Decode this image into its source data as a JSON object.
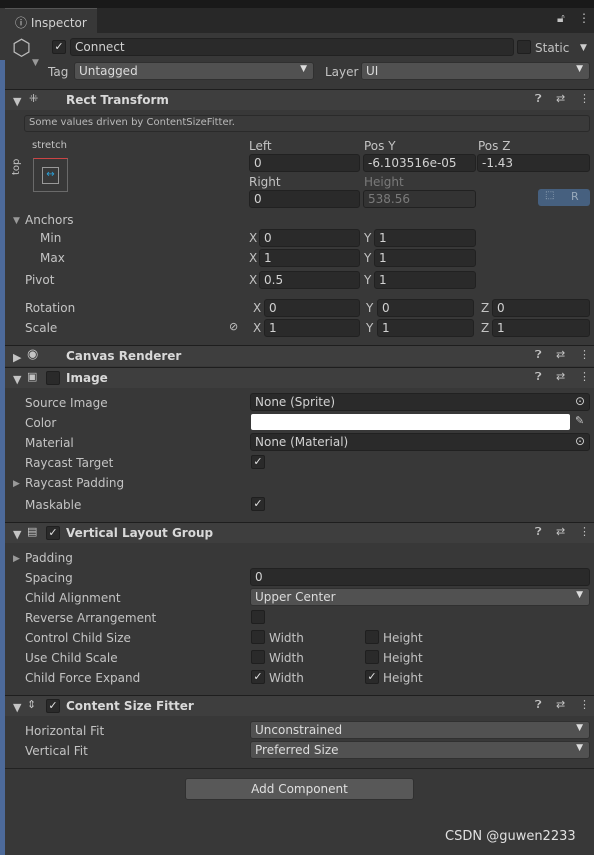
{
  "tab": {
    "title": "Inspector",
    "icon": "info-icon"
  },
  "object": {
    "active": true,
    "name": "Connect",
    "static_label": "Static",
    "tag_label": "Tag",
    "tag": "Untagged",
    "layer_label": "Layer",
    "layer": "UI"
  },
  "rect": {
    "title": "Rect Transform",
    "help": "Some values driven by ContentSizeFitter.",
    "anchor_h": "stretch",
    "anchor_v": "top",
    "left_label": "Left",
    "left": "0",
    "posy_label": "Pos Y",
    "posy": "-6.103516e-05",
    "posz_label": "Pos Z",
    "posz": "-1.43",
    "right_label": "Right",
    "right": "0",
    "height_label": "Height",
    "height": "538.56",
    "r_label": "R",
    "anchors_label": "Anchors",
    "min_label": "Min",
    "min_x": "0",
    "min_y": "1",
    "max_label": "Max",
    "max_x": "1",
    "max_y": "1",
    "pivot_label": "Pivot",
    "pivot_x": "0.5",
    "pivot_y": "1",
    "rotation_label": "Rotation",
    "rot_x": "0",
    "rot_y": "0",
    "rot_z": "0",
    "scale_label": "Scale",
    "scale_x": "1",
    "scale_y": "1",
    "scale_z": "1",
    "x": "X",
    "y": "Y",
    "z": "Z"
  },
  "canvas_renderer": {
    "title": "Canvas Renderer"
  },
  "image": {
    "title": "Image",
    "enabled": false,
    "source_label": "Source Image",
    "source": "None (Sprite)",
    "color_label": "Color",
    "color": "#ffffff",
    "material_label": "Material",
    "material": "None (Material)",
    "raycast_label": "Raycast Target",
    "raycast": true,
    "padding_label": "Raycast Padding",
    "maskable_label": "Maskable",
    "maskable": true
  },
  "vlg": {
    "title": "Vertical Layout Group",
    "enabled": true,
    "padding_label": "Padding",
    "spacing_label": "Spacing",
    "spacing": "0",
    "alignment_label": "Child Alignment",
    "alignment": "Upper Center",
    "reverse_label": "Reverse Arrangement",
    "control_label": "Control Child Size",
    "use_scale_label": "Use Child Scale",
    "force_label": "Child Force Expand",
    "width": "Width",
    "height": "Height"
  },
  "csf": {
    "title": "Content Size Fitter",
    "enabled": true,
    "hfit_label": "Horizontal Fit",
    "hfit": "Unconstrained",
    "vfit_label": "Vertical Fit",
    "vfit": "Preferred Size"
  },
  "add_component": "Add Component",
  "watermark": "CSDN @guwen2233"
}
